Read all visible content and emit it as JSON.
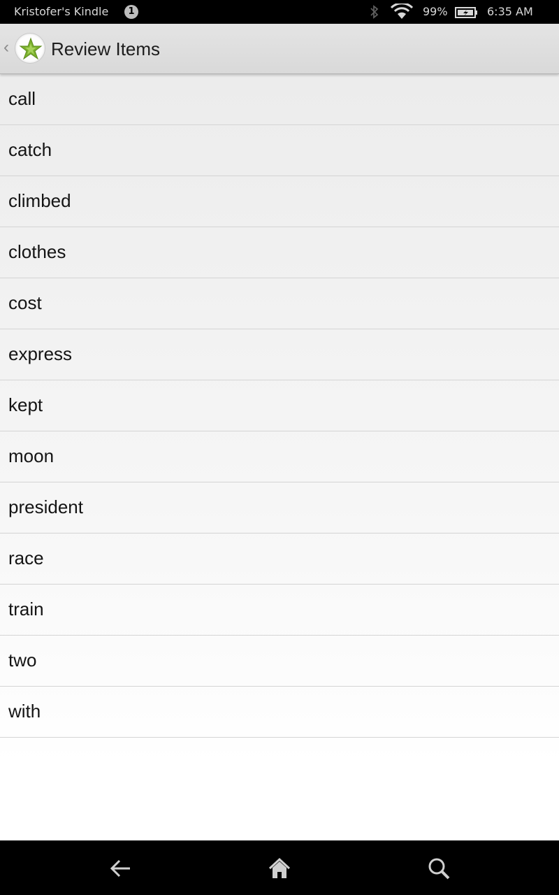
{
  "status_bar": {
    "device_name": "Kristofer's Kindle",
    "notification_count": "1",
    "battery_percent": "99%",
    "time": "6:35 AM",
    "icons": [
      "bluetooth-icon",
      "wifi-icon",
      "battery-charging-icon"
    ]
  },
  "action_bar": {
    "title": "Review Items",
    "app_icon": "star-icon",
    "up_indicator": "‹"
  },
  "review_items": [
    "call",
    "catch",
    "climbed",
    "clothes",
    "cost",
    "express",
    "kept",
    "moon",
    "president",
    "race",
    "train",
    "two",
    "with"
  ],
  "nav_bar": {
    "buttons": [
      "back-arrow-icon",
      "home-icon",
      "search-icon"
    ]
  },
  "colors": {
    "accent_star": "#7ab02c",
    "status_bar_bg": "#000000",
    "nav_bar_bg": "#000000",
    "action_bar_bg": "#dedede"
  }
}
